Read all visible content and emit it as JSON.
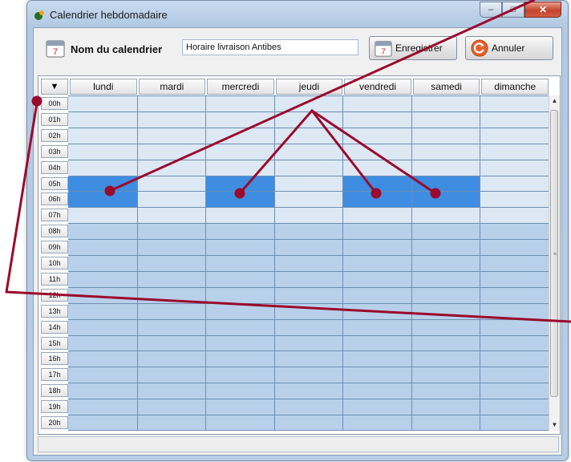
{
  "window": {
    "title": "Calendrier hebdomadaire",
    "minimize": "–",
    "maximize": "□",
    "close": "✕"
  },
  "toolbar": {
    "name_label": "Nom du calendrier",
    "name_value": "Horaire livraison Antibes",
    "save_label": "Enregistrer",
    "cancel_label": "Annuler"
  },
  "grid": {
    "corner_label": "▼",
    "days": [
      "lundi",
      "mardi",
      "mercredi",
      "jeudi",
      "vendredi",
      "samedi",
      "dimanche"
    ],
    "hours": [
      "00h",
      "01h",
      "02h",
      "03h",
      "04h",
      "05h",
      "06h",
      "07h",
      "08h",
      "09h",
      "10h",
      "11h",
      "12h",
      "13h",
      "14h",
      "15h",
      "16h",
      "17h",
      "18h",
      "19h",
      "20h"
    ],
    "selection": {
      "days": [
        "lundi",
        "mercredi",
        "vendredi",
        "samedi"
      ],
      "hours": [
        "05h",
        "06h"
      ]
    }
  },
  "scrollbar": {
    "up": "▲",
    "down": "▼",
    "grip": "≡"
  },
  "colors": {
    "accent_selection": "#3e8de0",
    "annotation": "#9b0a2c",
    "cell": "#dce8f4",
    "cell_shaded": "#b8d0ea"
  },
  "icons": [
    "app-icon",
    "calendar-icon",
    "save-icon",
    "cancel-icon",
    "dropdown-icon"
  ]
}
